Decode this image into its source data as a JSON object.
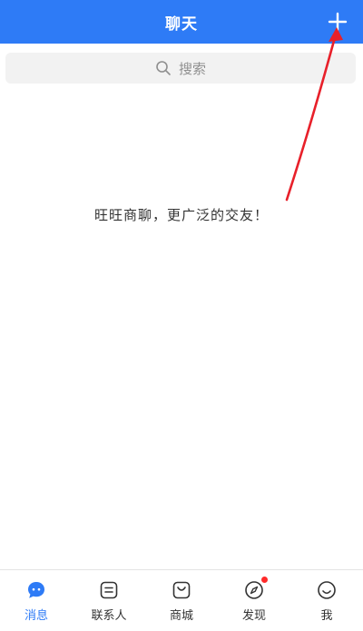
{
  "colors": {
    "header_bg": "#2e7bf6",
    "search_bg": "#f2f2f2",
    "active": "#2e7bf6",
    "badge": "#ff2a2a",
    "annotation_arrow": "#e8202a"
  },
  "header": {
    "title": "聊天",
    "plus_icon": "plus-icon"
  },
  "search": {
    "placeholder": "搜索",
    "icon": "search-icon"
  },
  "empty_state": {
    "message": "旺旺商聊，更广泛的交友！"
  },
  "bottom_nav": {
    "items": [
      {
        "label": "消息",
        "icon": "chat-bubble-icon",
        "active": true
      },
      {
        "label": "联系人",
        "icon": "contacts-icon",
        "active": false
      },
      {
        "label": "商城",
        "icon": "shop-bag-icon",
        "active": false
      },
      {
        "label": "发现",
        "icon": "compass-icon",
        "active": false,
        "badge": true
      },
      {
        "label": "我",
        "icon": "smiley-icon",
        "active": false
      }
    ]
  }
}
